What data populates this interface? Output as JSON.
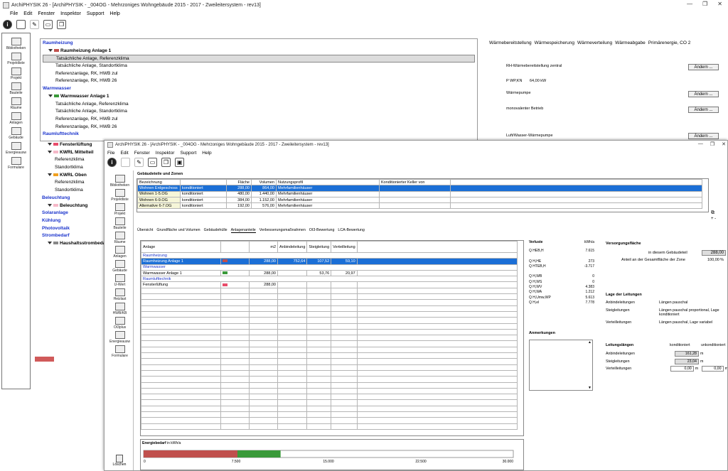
{
  "back": {
    "title": "ArchiPHYSIK 26 - [ArchiPHYSIK - _004OG - Mehrzoniges Wohngebäude 2015 - 2017 - Zweileitersystem - rev13]",
    "menu": [
      "File",
      "Edit",
      "Fenster",
      "Inspektor",
      "Support",
      "Help"
    ],
    "sidebar": [
      "Bibliotheken",
      "Projektliste",
      "Projekt",
      "Bauteile",
      "Räume",
      "Anlagen",
      "Gebäude",
      "Energieausw",
      "Formulare"
    ],
    "tree": [
      {
        "t": "Raumheizung",
        "c": "blue",
        "i": 0
      },
      {
        "t": "Raumheizung Anlage 1",
        "c": "bold",
        "i": 1,
        "sq": "#c0504d"
      },
      {
        "t": "Tatsächliche Anlage, Referenzklima",
        "i": 2,
        "sel": true
      },
      {
        "t": "Tatsächliche Anlage, Standortklima",
        "i": 2
      },
      {
        "t": "Referenzanlage, RK, HWB zul",
        "i": 2
      },
      {
        "t": "Referenzanlage, RK, HWB 26",
        "i": 2
      },
      {
        "t": "Warmwasser",
        "c": "blue",
        "i": 0
      },
      {
        "t": "Warmwasser Anlage 1",
        "c": "bold",
        "i": 1,
        "sq": "#3a9a3a"
      },
      {
        "t": "Tatsächliche Anlage, Referenzklima",
        "i": 2
      },
      {
        "t": "Tatsächliche Anlage, Standortklima",
        "i": 2
      },
      {
        "t": "Referenzanlage, RK, HWB zul",
        "i": 2
      },
      {
        "t": "Referenzanlage, RK, HWB 26",
        "i": 2
      },
      {
        "t": "Raumlufttechnik",
        "c": "blue",
        "i": 0
      },
      {
        "t": "Fensterlüftung",
        "c": "bold",
        "i": 1,
        "sq": "#e84c6a"
      },
      {
        "t": "KWRL Mittelteil",
        "c": "bold",
        "i": 1,
        "sq": "#f5b8c8"
      },
      {
        "t": "Referenzklima",
        "i": 2
      },
      {
        "t": "Standortklima",
        "i": 2
      },
      {
        "t": "KWRL Oben",
        "c": "bold",
        "i": 1,
        "sq": "#f0a020"
      },
      {
        "t": "Referenzklima",
        "i": 2
      },
      {
        "t": "Standortklima",
        "i": 2
      },
      {
        "t": "Beleuchtung",
        "c": "blue",
        "i": 0
      },
      {
        "t": "Beleuchtung",
        "c": "bold",
        "i": 1,
        "sq": "#f5b8c8"
      },
      {
        "t": "Solaranlage",
        "c": "blue",
        "i": 0
      },
      {
        "t": "Kühlung",
        "c": "blue",
        "i": 0
      },
      {
        "t": "Photovoltaik",
        "c": "blue",
        "i": 0
      },
      {
        "t": "Strombedarf",
        "c": "blue",
        "i": 0
      },
      {
        "t": "Haushaltsstrombedarf",
        "c": "bold",
        "i": 1,
        "sq": "#888888"
      }
    ],
    "tabs": [
      "Wärmebereitstellung",
      "Wärmespeicherung",
      "Wärmeverteilung",
      "Wärmeabgabe",
      "Primärenergie, CO 2"
    ],
    "right": {
      "l1": "RH-Wärmebereitstellung zentral",
      "l2": "P WP,KN",
      "v2": "64,00 kW",
      "l3": "Wärmepumpe",
      "l4": "monovalenter Betrieb",
      "l5": "Luft/Wasser-Wärmepumpe",
      "btn": "Ändern ..."
    }
  },
  "front": {
    "title": "ArchiPHYSIK 26 - [ArchiPHYSIK - _004OG - Mehrzoniges Wohngebäude 2015 - 2017 - Zweileitersystem - rev13]",
    "menu": [
      "File",
      "Edit",
      "Fenster",
      "Inspektor",
      "Support",
      "Help"
    ],
    "sidebar": [
      "Bibliotheken",
      "Projektliste",
      "Projekt",
      "Bauteile",
      "Räume",
      "Anlagen",
      "Gebäude",
      "U-Wert",
      "Heizlast",
      "HWB/KB",
      "OI3plus",
      "Energieausw",
      "Formulare"
    ],
    "delete": "Löschen",
    "zones_title": "Gebäudeteile und Zonen",
    "zones_head": [
      "Bezeichnung",
      "",
      "Fläche",
      "Volumen",
      "Nutzungsprofil",
      "Konditionierter Keller von"
    ],
    "zones": [
      [
        "Wohnen Erdgeschoss",
        "konditioniert",
        "288,00",
        "864,00",
        "Mehrfamilienhäuser",
        ""
      ],
      [
        "Wohnen 1-5.OG",
        "konditioniert",
        "480,00",
        "1.440,00",
        "Mehrfamilienhäuser",
        ""
      ],
      [
        "Wohnen 6-9.OG",
        "konditioniert",
        "384,00",
        "1.152,00",
        "Mehrfamilienhäuser",
        ""
      ],
      [
        "Alternative 6-7.OG",
        "konditioniert",
        "192,00",
        "576,00",
        "Mehrfamilienhäuser",
        ""
      ]
    ],
    "subtabs": [
      "Übersicht",
      "Grundfläche und Volumen",
      "Gebäudehülle",
      "Anlagenanteile",
      "Verbesserungsmaßnahmen",
      "OI3-Bewertung",
      "LCA-Bewertung"
    ],
    "anl_head": [
      "Anlage",
      "",
      "m2",
      "Anbindeleitung",
      "Steigleitung",
      "Verteilleitung"
    ],
    "anl_rows": [
      {
        "sect": "Raumheizung"
      },
      {
        "c": [
          "Raumheizung Anlage 1",
          "",
          "288,00",
          "752,64",
          "107,52",
          "59,10"
        ],
        "sel": true,
        "sq": "#c0504d"
      },
      {
        "sect": "Warmwasser"
      },
      {
        "c": [
          "Warmwasser Anlage 1",
          "",
          "288,00",
          "",
          "53,76",
          "20,97"
        ],
        "sq": "#3a9a3a"
      },
      {
        "sect": "Raumlufttechnik"
      },
      {
        "c": [
          "Fensterlüftung",
          "",
          "288,00",
          "",
          "",
          ""
        ],
        "sq": "#e84c6a"
      }
    ],
    "verluste": {
      "title": "Verluste",
      "unit": "kWh/a",
      "rows": [
        [
          "Q HEB,H",
          "7.615"
        ],
        [
          "",
          ""
        ],
        [
          "Q H,HE",
          "273"
        ],
        [
          "Q HTEB,H",
          "-3.717"
        ],
        [
          "",
          ""
        ],
        [
          "Q H,WB",
          "0"
        ],
        [
          "Q H,WS",
          "0"
        ],
        [
          "Q H,WV",
          "4.383"
        ],
        [
          "Q H,WA",
          "1.212"
        ],
        [
          "Q H,Umw,WP",
          "5.613"
        ],
        [
          "Q H,el",
          "7.778"
        ]
      ]
    },
    "versorgung": {
      "title": "Versorgungsfläche",
      "l1": "in diesem Gebäudeteil",
      "v1": "288,00",
      "u1": "m²",
      "l2": "Anteil an der Gesamtfläche der Zone",
      "v2": "100,00",
      "u2": "%"
    },
    "lage": {
      "title": "Lage der Leitungen",
      "rows": [
        [
          "Anbindeleitungen",
          "Längen pauschal"
        ],
        [
          "Steigleitungen",
          "Längen pauschal proportional, Lage konditioniert"
        ],
        [
          "Verteilleitungen",
          "Längen pauschal, Lage variabel"
        ]
      ]
    },
    "anmerkungen": "Anmerkungen",
    "laengen": {
      "title": "Leitungslängen",
      "h1": "konditioniert",
      "h2": "unkonditioniert",
      "rows": [
        [
          "Anbindeleitungen",
          "161,28",
          "m"
        ],
        [
          "Steigleitungen",
          "23,04",
          "m"
        ],
        [
          "Verteilleitungen",
          "0,00",
          "m",
          "0,00",
          "m"
        ]
      ]
    },
    "energie": {
      "title": "Energiebedarf",
      "unit": "in kWh/a",
      "ticks": [
        "0",
        "7.500",
        "15.000",
        "22.500",
        "30.000"
      ]
    }
  },
  "chart_data": {
    "type": "bar",
    "title": "Energiebedarf",
    "xlabel": "in kWh/a",
    "xlim": [
      0,
      30000
    ],
    "categories": [
      "Raumheizung",
      "Warmwasser"
    ],
    "values": [
      7615,
      3500
    ],
    "colors": [
      "#c0504d",
      "#3a9a3a"
    ]
  }
}
